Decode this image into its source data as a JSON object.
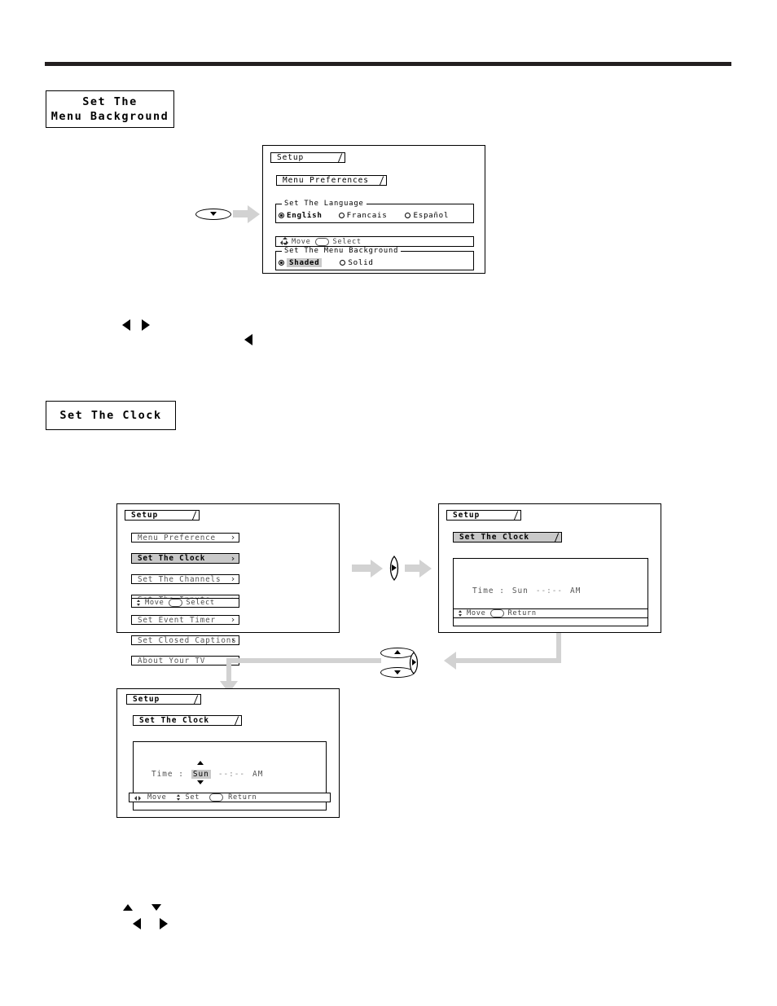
{
  "headings": {
    "menu_background": {
      "line1": "Set The",
      "line2": "Menu Background"
    },
    "set_the_clock": "Set The Clock"
  },
  "panel_menu_preferences": {
    "tab_setup": "Setup",
    "tab_menu_preferences": "Menu Preferences",
    "language_group": {
      "caption": "Set The Language",
      "options": [
        {
          "label": "English",
          "selected": true
        },
        {
          "label": "Francais",
          "selected": false
        },
        {
          "label": "Español",
          "selected": false
        }
      ]
    },
    "background_group": {
      "caption": "Set The Menu Background",
      "options": [
        {
          "label": "Shaded",
          "selected": true,
          "highlighted": true
        },
        {
          "label": "Solid",
          "selected": false,
          "highlighted": false
        }
      ]
    },
    "hint": {
      "move": "Move",
      "select": "Select"
    }
  },
  "panel_setup_list": {
    "tab_setup": "Setup",
    "items": [
      {
        "label": "Menu Preference",
        "highlighted": false
      },
      {
        "label": "Set The Clock",
        "highlighted": true
      },
      {
        "label": "Set The Channels",
        "highlighted": false
      },
      {
        "label": "Set The Inputs",
        "highlighted": false
      },
      {
        "label": "Set Event Timer",
        "highlighted": false
      },
      {
        "label": "Set Closed Captions",
        "highlighted": false
      },
      {
        "label": "About Your TV",
        "highlighted": false
      }
    ],
    "hint": {
      "move": "Move",
      "select": "Select"
    }
  },
  "panel_clock_view": {
    "tab_setup": "Setup",
    "tab_clock": "Set The Clock",
    "time_label": "Time :",
    "day": "Sun",
    "time_value": "--:--",
    "meridiem": "AM",
    "hint": {
      "move": "Move",
      "return": "Return"
    }
  },
  "panel_clock_edit": {
    "tab_setup": "Setup",
    "tab_clock": "Set The Clock",
    "time_label": "Time :",
    "day": "Sun",
    "time_value": "--:--",
    "meridiem": "AM",
    "hint": {
      "move": "Move",
      "set": "Set",
      "return": "Return"
    }
  },
  "icons": {
    "down_oval_button": "down-oval-button",
    "right_lens_button": "right-lens-button",
    "updown_right_button": "updown-right-button",
    "flow_arrow": "flow-arrow"
  },
  "key_hints": {
    "row_lr_top": [
      "left-triangle",
      "right-triangle"
    ],
    "row_l_single": [
      "left-triangle"
    ],
    "row_ud": [
      "up-triangle",
      "down-triangle"
    ],
    "row_lr_bottom": [
      "left-triangle",
      "right-triangle"
    ]
  },
  "colors": {
    "rule": "#231f20",
    "highlight": "#c9c9c9",
    "flow": "#d2d2d2",
    "border": "#000000"
  }
}
